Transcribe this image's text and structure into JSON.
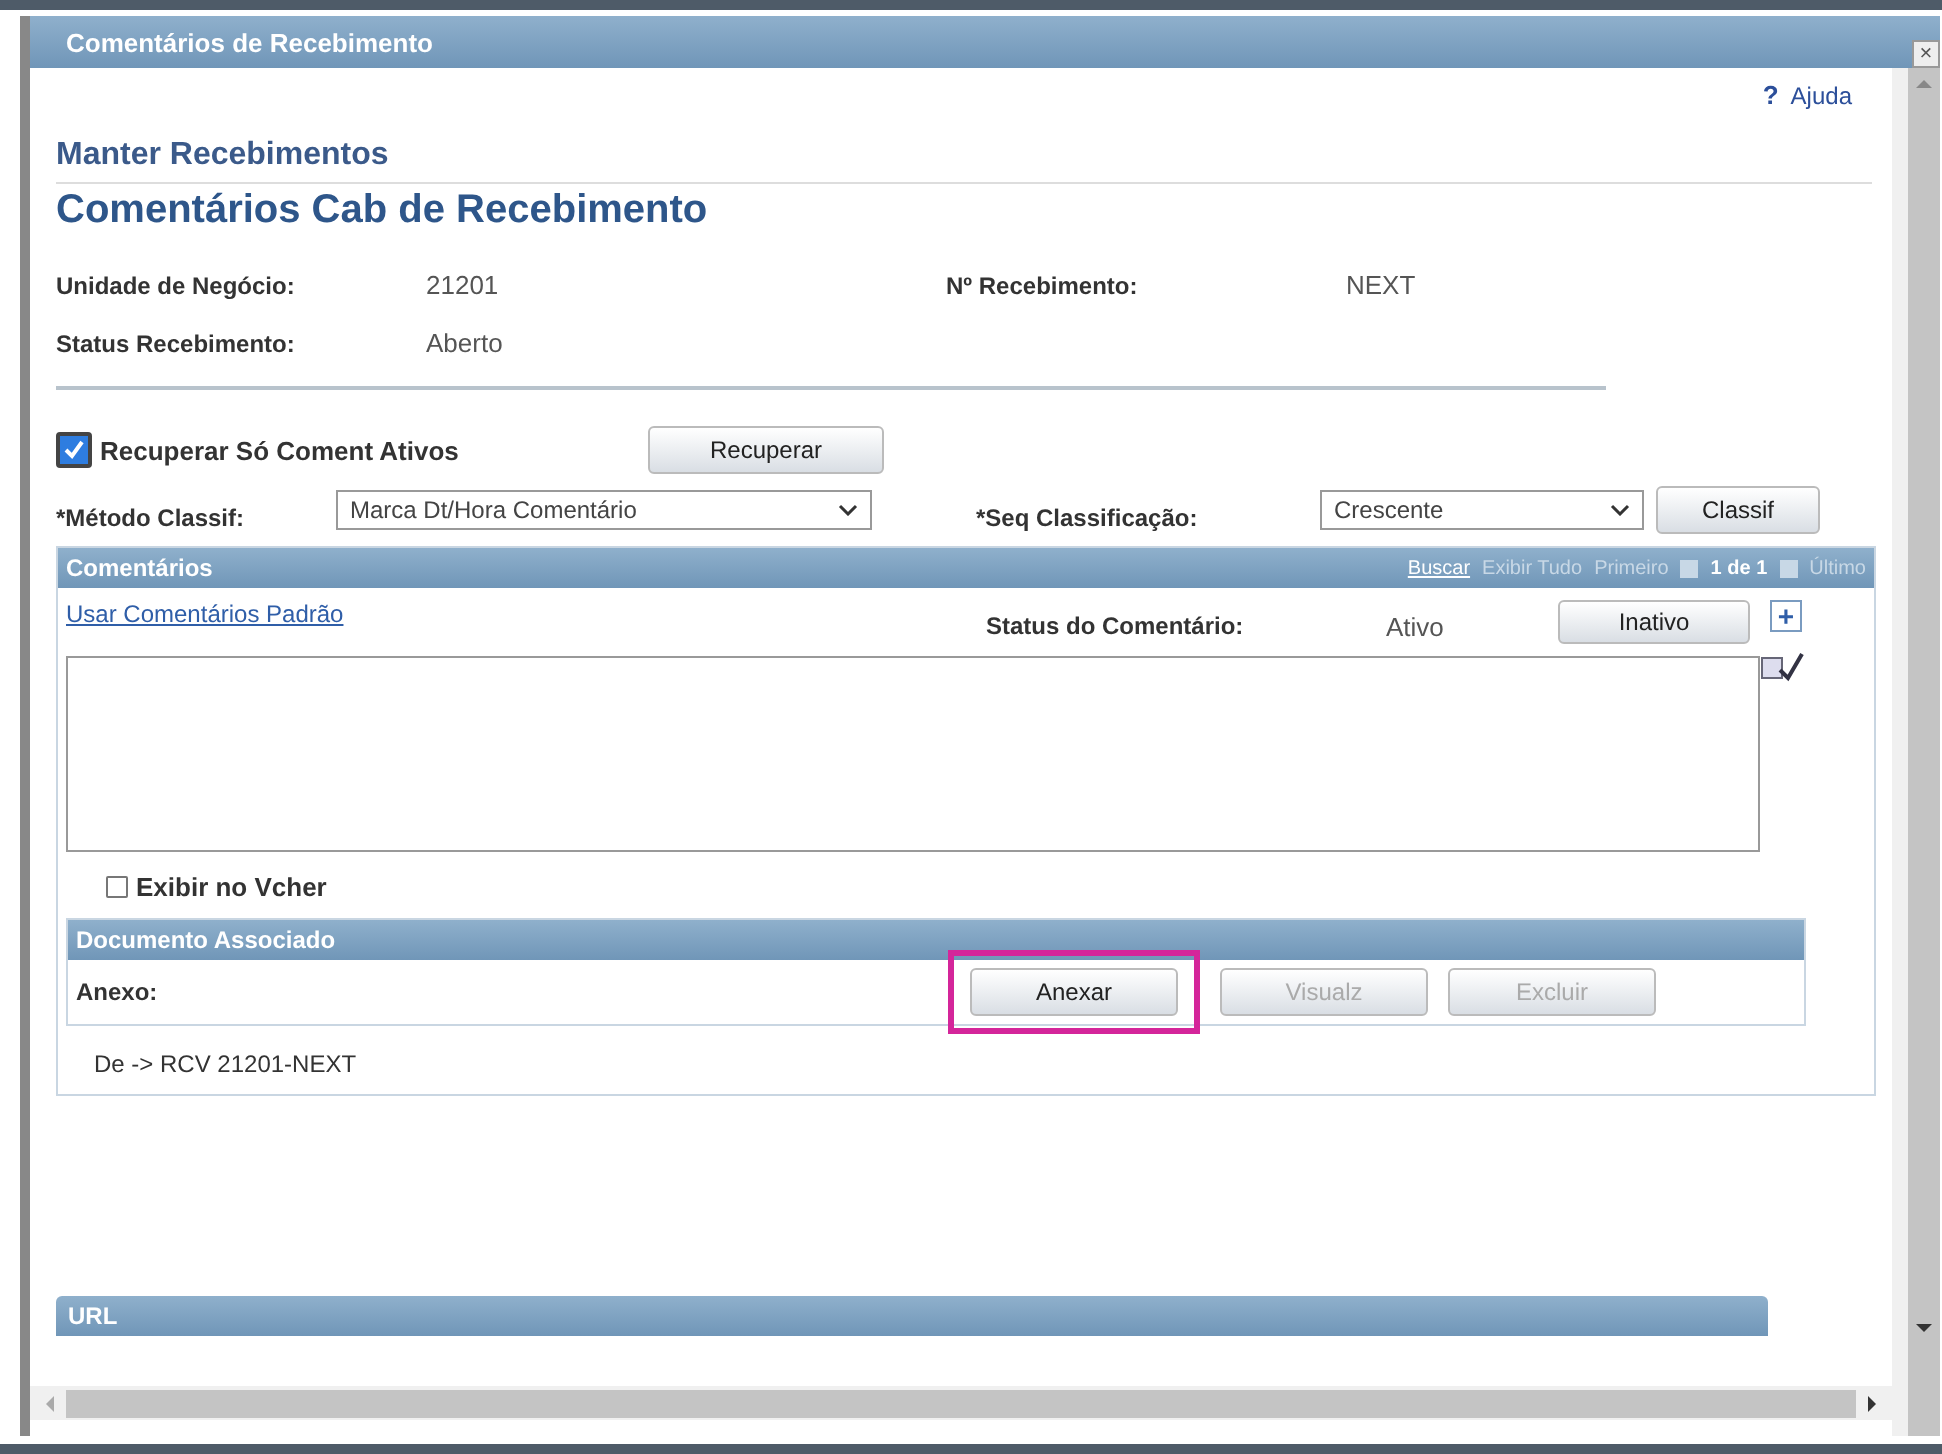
{
  "window": {
    "title": "Comentários de Recebimento",
    "close": "×"
  },
  "help": {
    "icon": "?",
    "label": "Ajuda"
  },
  "breadcrumb": "Manter Recebimentos",
  "page_title": "Comentários Cab de Recebimento",
  "fields": [
    {
      "label": "Unidade de Negócio:",
      "value": "21201"
    },
    {
      "label": "Nº Recebimento:",
      "value": "NEXT"
    },
    {
      "label": "Status Recebimento:",
      "value": "Aberto"
    }
  ],
  "active_only": {
    "label": "Recuperar Só Coment Ativos",
    "checked": true
  },
  "retrieve_button": "Recuperar",
  "sort_method": {
    "label": "*Método Classif:",
    "value": "Marca Dt/Hora Comentário"
  },
  "sort_order": {
    "label": "*Seq Classificação:",
    "value": "Crescente"
  },
  "sort_button": "Classif",
  "comments": {
    "title": "Comentários",
    "nav": [
      {
        "label": "Buscar",
        "kind": "link"
      },
      {
        "label": "Exibir Tudo",
        "kind": "muted"
      },
      {
        "label": "Primeiro",
        "kind": "muted"
      },
      {
        "label": "1 de 1",
        "kind": "count"
      },
      {
        "label": "Último",
        "kind": "muted"
      }
    ],
    "default_link": "Usar Comentários Padrão",
    "status_label": "Status do Comentário:",
    "status_value": "Ativo",
    "inactive_button": "Inativo",
    "add": "+",
    "show_voucher": {
      "label": "Exibir no Vcher",
      "checked": false
    },
    "doc": {
      "title": "Documento Associado",
      "label": "Anexo:",
      "buttons": [
        {
          "label": "Anexar",
          "disabled": false,
          "highlighted": true
        },
        {
          "label": "Visualz",
          "disabled": true,
          "highlighted": false
        },
        {
          "label": "Excluir",
          "disabled": true,
          "highlighted": false
        }
      ]
    },
    "reference": "De -> RCV 21201-NEXT"
  },
  "url_section": {
    "title": "URL"
  }
}
